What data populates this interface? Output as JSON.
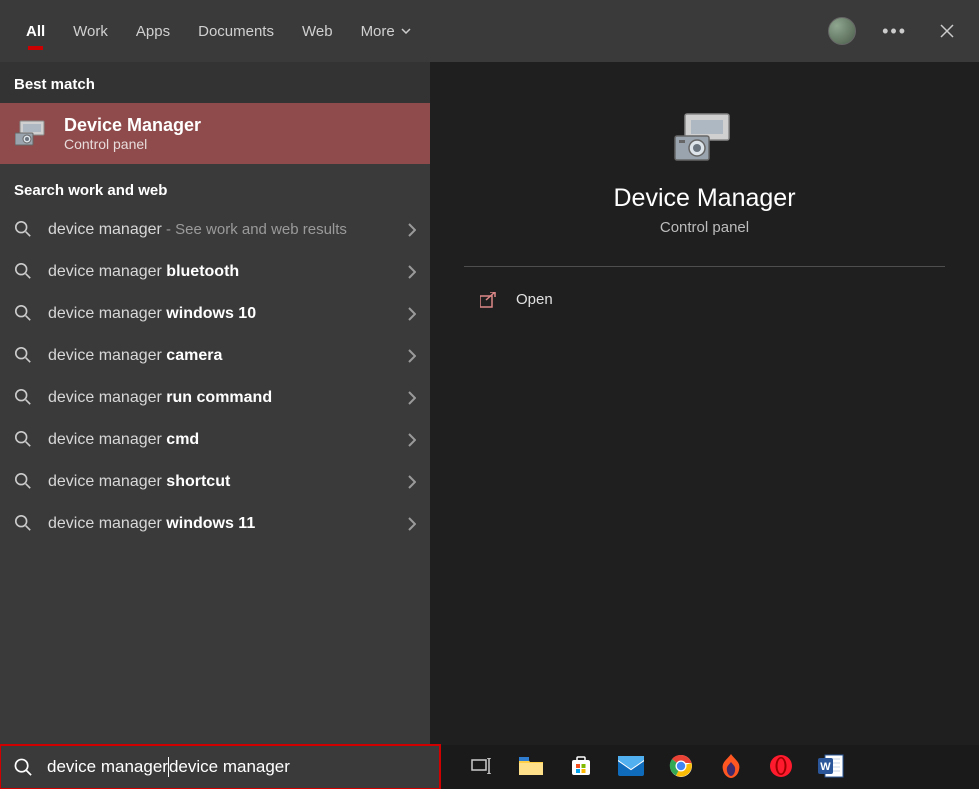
{
  "tabs": {
    "all": "All",
    "work": "Work",
    "apps": "Apps",
    "documents": "Documents",
    "web": "Web",
    "more": "More"
  },
  "sections": {
    "best_match": "Best match",
    "work_web": "Search work and web"
  },
  "best_match": {
    "title": "Device Manager",
    "subtitle": "Control panel"
  },
  "suggestions": [
    {
      "prefix": "device manager",
      "bold": "",
      "note": " - See work and web results"
    },
    {
      "prefix": "device manager ",
      "bold": "bluetooth",
      "note": ""
    },
    {
      "prefix": "device manager ",
      "bold": "windows 10",
      "note": ""
    },
    {
      "prefix": "device manager ",
      "bold": "camera",
      "note": ""
    },
    {
      "prefix": "device manager ",
      "bold": "run command",
      "note": ""
    },
    {
      "prefix": "device manager ",
      "bold": "cmd",
      "note": ""
    },
    {
      "prefix": "device manager ",
      "bold": "shortcut",
      "note": ""
    },
    {
      "prefix": "device manager ",
      "bold": "windows 11",
      "note": ""
    }
  ],
  "detail": {
    "title": "Device Manager",
    "subtitle": "Control panel",
    "open": "Open"
  },
  "search": {
    "value": "device manager"
  }
}
